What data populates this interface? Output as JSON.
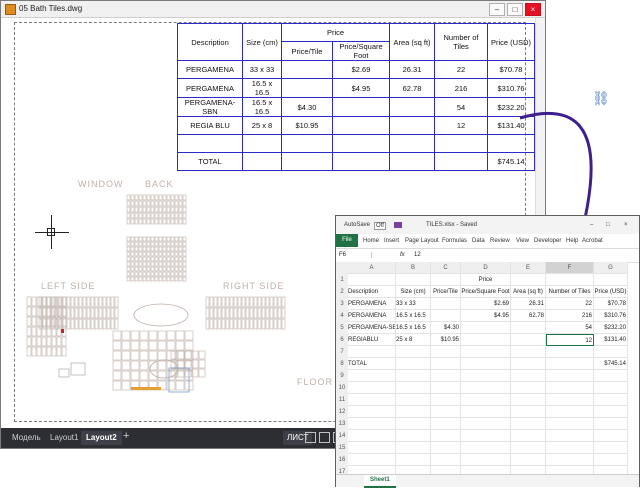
{
  "cad": {
    "title": "05 Bath Tiles.dwg",
    "win_min": "–",
    "win_max": "□",
    "win_close": "×",
    "tabs": [
      "Модель",
      "Layout1",
      "Layout2"
    ],
    "active_tab": "Layout2",
    "plus": "+",
    "status_label": "ЛИСТ",
    "labels": {
      "window": "WINDOW",
      "back": "BACK",
      "left_side": "LEFT SIDE",
      "right_side": "RIGHT SIDE",
      "floor": "FLOOR"
    },
    "table": {
      "h_description": "Description",
      "h_size": "Size (cm)",
      "h_price": "Price",
      "h_price_tile": "Price/Tile",
      "h_price_sqft": "Price/Square Foot",
      "h_area": "Area (sq ft)",
      "h_number": "Number of Tiles",
      "h_price_usd": "Price (USD)",
      "rows": [
        {
          "d": "PERGAMENA",
          "s": "33 x 33",
          "pt": "",
          "psf": "$2.69",
          "a": "26.31",
          "n": "22",
          "p": "$70.78"
        },
        {
          "d": "PERGAMENA",
          "s": "16.5 x 16.5",
          "pt": "",
          "psf": "$4.95",
          "a": "62.78",
          "n": "216",
          "p": "$310.76"
        },
        {
          "d": "PERGAMENA-SBN",
          "s": "16.5 x 16.5",
          "pt": "$4.30",
          "psf": "",
          "a": "",
          "n": "54",
          "p": "$232.20"
        },
        {
          "d": "REGIA BLU",
          "s": "25 x 8",
          "pt": "$10.95",
          "psf": "",
          "a": "",
          "n": "12",
          "p": "$131.40"
        }
      ],
      "total_label": "TOTAL",
      "total_value": "$745.14"
    }
  },
  "excel": {
    "autosave": "AutoSave",
    "autosave_state": "Off",
    "file_name": "TILES.xlsx - Saved",
    "ribbon_tabs": [
      "File",
      "Home",
      "Insert",
      "Page Layout",
      "Formulas",
      "Data",
      "Review",
      "View",
      "Developer",
      "Help",
      "Acrobat"
    ],
    "name_box": "F6",
    "formula_fx": "fx",
    "formula_value": "12",
    "col_headers": [
      "A",
      "B",
      "C",
      "D",
      "E",
      "F",
      "G"
    ],
    "rows": [
      {
        "n": "1",
        "cells": [
          "",
          "",
          "",
          "Price",
          "",
          "",
          ""
        ]
      },
      {
        "n": "2",
        "cells": [
          "Description",
          "Size (cm)",
          "Price/Tile",
          "Price/Square Foot",
          "Area (sq ft)",
          "Number of Tiles",
          "Price (USD)"
        ]
      },
      {
        "n": "3",
        "cells": [
          "PERGAMENA",
          "33 x 33",
          "",
          "$2.69",
          "26.31",
          "22",
          "$70.78"
        ]
      },
      {
        "n": "4",
        "cells": [
          "PERGAMENA",
          "16.5 x 16.5",
          "",
          "$4.95",
          "62.78",
          "216",
          "$310.76"
        ]
      },
      {
        "n": "5",
        "cells": [
          "PERGAMENA-SBN",
          "16.5 x 16.5",
          "$4.30",
          "",
          "",
          "54",
          "$232.20"
        ]
      },
      {
        "n": "6",
        "cells": [
          "REGIABLU",
          "25 x 8",
          "$10.95",
          "",
          "",
          "12",
          "$131.40"
        ]
      },
      {
        "n": "7",
        "cells": [
          "",
          "",
          "",
          "",
          "",
          "",
          ""
        ]
      },
      {
        "n": "8",
        "cells": [
          "TOTAL",
          "",
          "",
          "",
          "",
          "",
          "$745.14"
        ]
      },
      {
        "n": "9",
        "cells": [
          "",
          "",
          "",
          "",
          "",
          "",
          ""
        ]
      },
      {
        "n": "10",
        "cells": [
          "",
          "",
          "",
          "",
          "",
          "",
          ""
        ]
      },
      {
        "n": "11",
        "cells": [
          "",
          "",
          "",
          "",
          "",
          "",
          ""
        ]
      },
      {
        "n": "12",
        "cells": [
          "",
          "",
          "",
          "",
          "",
          "",
          ""
        ]
      },
      {
        "n": "13",
        "cells": [
          "",
          "",
          "",
          "",
          "",
          "",
          ""
        ]
      },
      {
        "n": "14",
        "cells": [
          "",
          "",
          "",
          "",
          "",
          "",
          ""
        ]
      },
      {
        "n": "15",
        "cells": [
          "",
          "",
          "",
          "",
          "",
          "",
          ""
        ]
      },
      {
        "n": "16",
        "cells": [
          "",
          "",
          "",
          "",
          "",
          "",
          ""
        ]
      },
      {
        "n": "17",
        "cells": [
          "",
          "",
          "",
          "",
          "",
          "",
          ""
        ]
      }
    ],
    "sheet_tab": "Sheet1"
  },
  "colors": {
    "table_border": "#2b2bcc",
    "arrow": "#3d1f8f",
    "excel_green": "#217346",
    "tile_stroke": "#bfb0a8"
  }
}
